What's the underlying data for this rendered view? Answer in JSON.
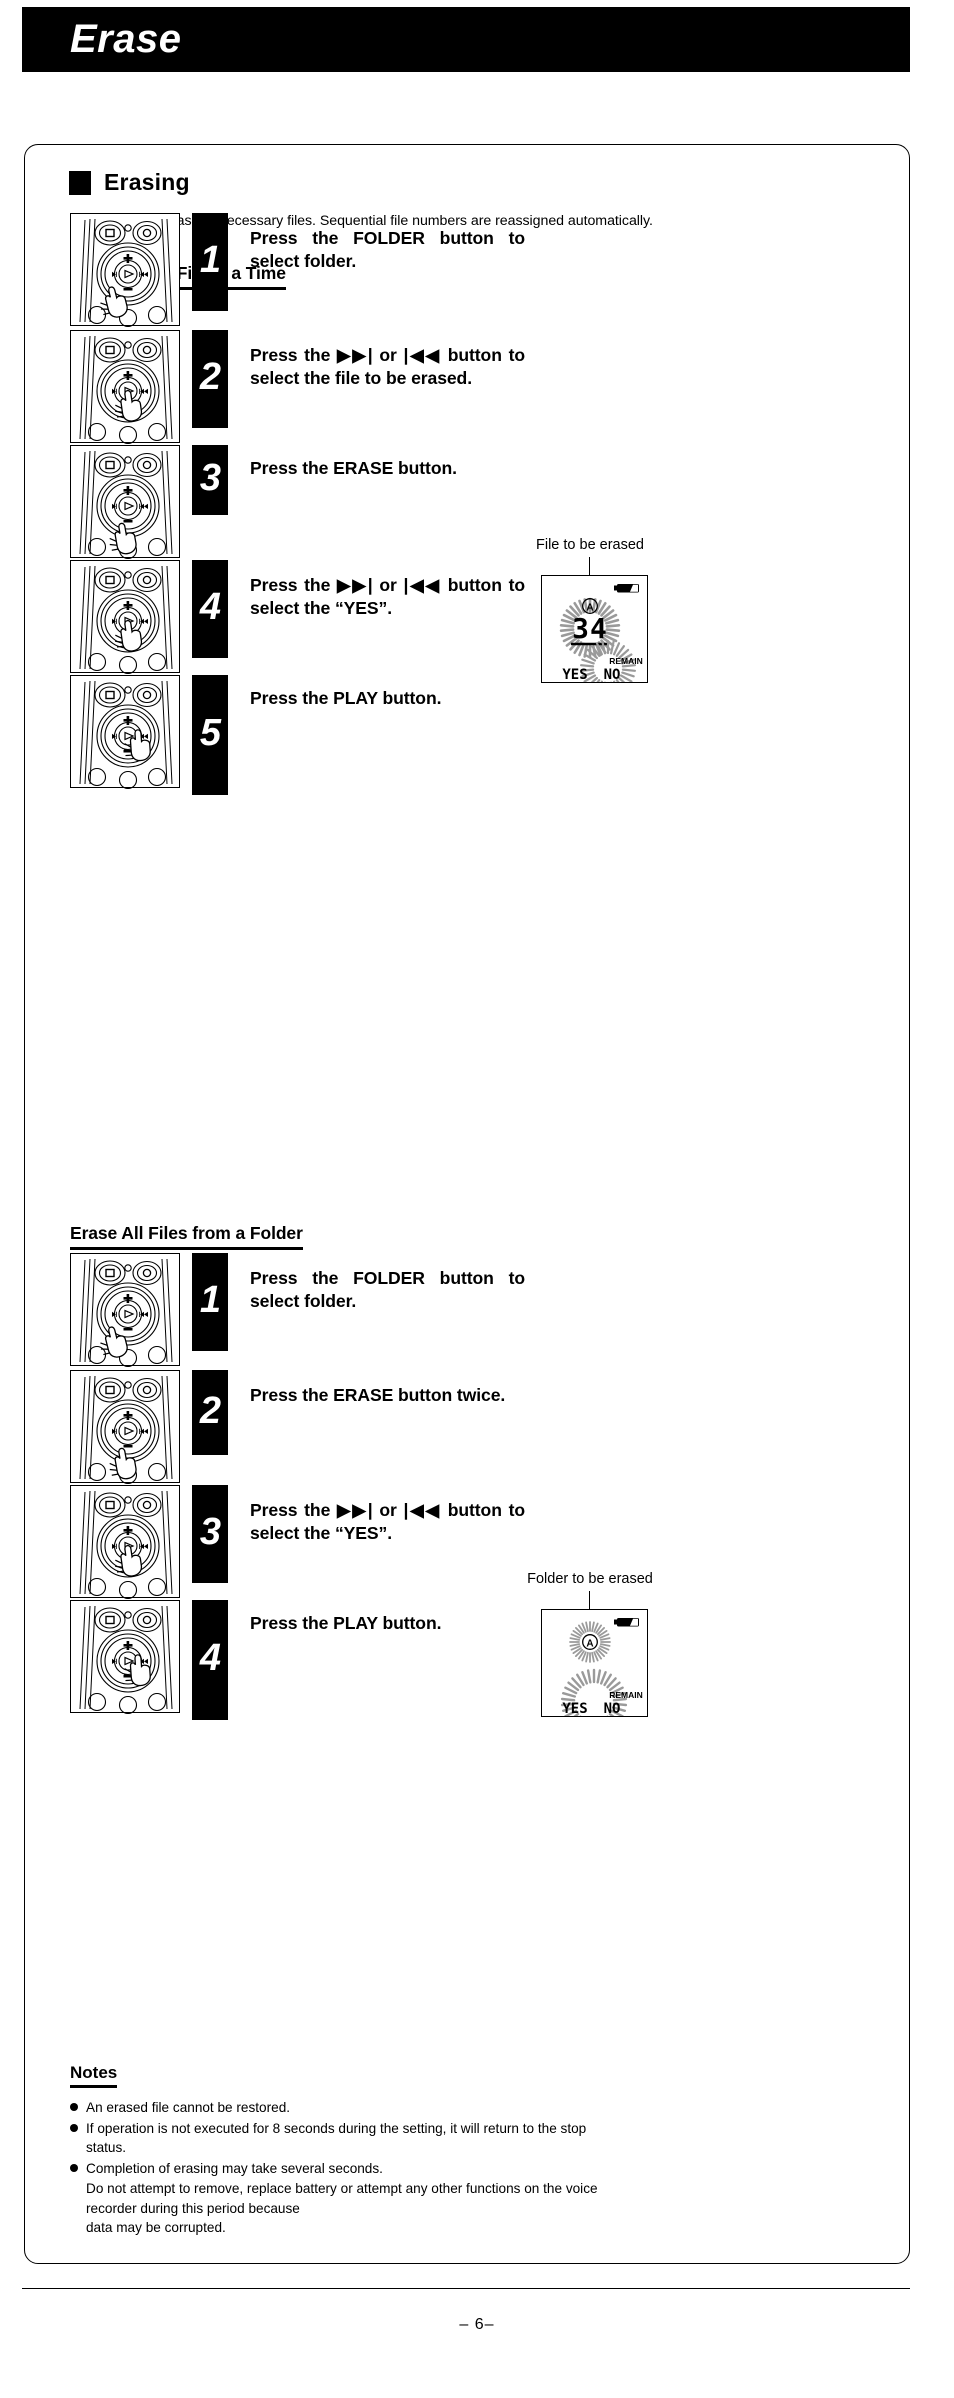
{
  "banner": {
    "title": "Erase"
  },
  "section": {
    "title": "Erasing",
    "intro": "You can easily erase unnecessary files. Sequential file numbers are reassigned automatically."
  },
  "subheadings": {
    "one_file": "Erasing One File at a Time",
    "all_files": "Erase All Files from a Folder"
  },
  "steps_one_file": [
    {
      "number": "1",
      "text": "Press the FOLDER button to select folder."
    },
    {
      "number": "2",
      "text": "Press the ▶▶| or |◀◀ button to select the file to be erased."
    },
    {
      "number": "3",
      "text": "Press the ERASE button."
    },
    {
      "number": "4",
      "text": "Press the ▶▶| or |◀◀ button to select the “YES”."
    },
    {
      "number": "5",
      "text": "Press the PLAY button."
    }
  ],
  "steps_all_files": [
    {
      "number": "1",
      "text": "Press the FOLDER button to select folder."
    },
    {
      "number": "2",
      "text": "Press the ERASE button twice."
    },
    {
      "number": "3",
      "text": "Press the ▶▶| or |◀◀ button to select the “YES”."
    },
    {
      "number": "4",
      "text": "Press the PLAY button."
    }
  ],
  "lcd_file": {
    "caption": "File to be erased",
    "folder_indicator": "A",
    "file_number": "34",
    "remain_label": "REMAIN",
    "prompt_yes": "YES",
    "prompt_no": "NO"
  },
  "lcd_folder": {
    "caption": "Folder to be erased",
    "folder_indicator": "A",
    "remain_label": "REMAIN",
    "prompt_yes": "YES",
    "prompt_no": "NO"
  },
  "notes": {
    "title": "Notes",
    "items": [
      {
        "text": "An erased file cannot be restored.",
        "continuations": []
      },
      {
        "text": "If operation is not executed for 8 seconds during the setting, it will return to the stop",
        "continuations": [
          "status."
        ]
      },
      {
        "text": "Completion of erasing may take several seconds.",
        "continuations": [
          "Do not attempt to remove, replace battery or attempt any other functions on the voice",
          "recorder during this period because",
          "data may be corrupted."
        ]
      }
    ]
  },
  "footer": {
    "page": "– 6–"
  }
}
